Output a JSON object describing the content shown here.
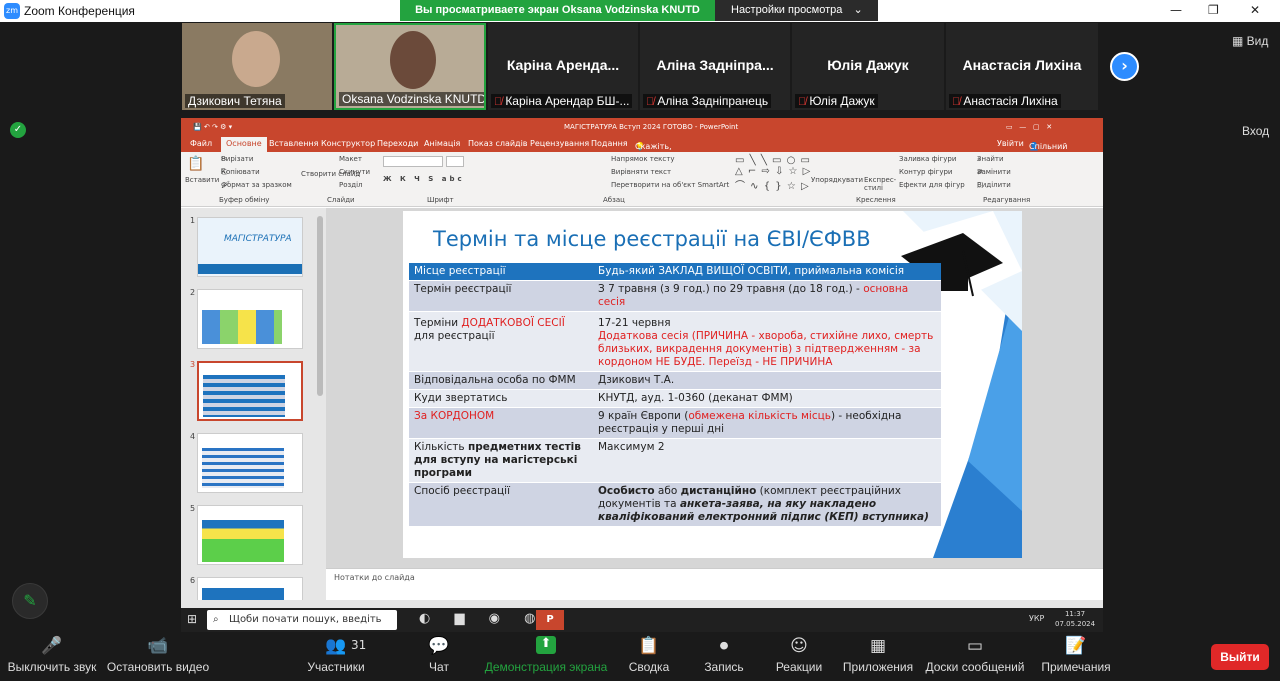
{
  "window": {
    "title": "Zoom Конференция",
    "logo": "zm"
  },
  "share_banner": "Вы просматриваете экран Oksana Vodzinska KNUTD",
  "view_options": "Настройки просмотра",
  "right_buttons": {
    "view": "Вид",
    "exit": "Вход"
  },
  "participants": [
    {
      "big": "",
      "name": "Дзикович Тетяна",
      "muted": false
    },
    {
      "big": "",
      "name": "Oksana Vodzinska KNUTD",
      "muted": false
    },
    {
      "big": "Каріна Аренда...",
      "name": "Каріна Арендар БШ-...",
      "muted": true
    },
    {
      "big": "Аліна Задніпра...",
      "name": "Аліна Задніпранець",
      "muted": true
    },
    {
      "big": "Юлія Дажук",
      "name": "Юлія Дажук",
      "muted": true
    },
    {
      "big": "Анастасія Лихіна",
      "name": "Анастасія Лихіна",
      "muted": true
    }
  ],
  "ppt": {
    "title": "МАГІСТРАТУРА Вступ 2024 ГОТОВО - PowerPoint",
    "signin": "Увійти",
    "share": "Спільний доступ",
    "tabs": [
      "Файл",
      "Основне",
      "Вставлення",
      "Конструктор",
      "Переходи",
      "Анімація",
      "Показ слайдів",
      "Рецензування",
      "Подання"
    ],
    "tell_me": "Скажіть, що потрібно зробити...",
    "ribbon": {
      "paste": "Вставити",
      "cut": "Вирізати",
      "copy": "Копіювати",
      "format_painter": "Формат за зразком",
      "clipboard": "Буфер обміну",
      "new_slide": "Створити слайд",
      "layout": "Макет",
      "reset": "Скинути",
      "section": "Розділ",
      "slides": "Слайди",
      "font": "Шрифт",
      "text_dir": "Напрямок тексту",
      "align_text": "Вирівняти текст",
      "smartart": "Перетворити на об'єкт SmartArt",
      "paragraph": "Абзац",
      "arrange": "Упорядкувати",
      "quick_styles": "Експрес-стилі",
      "fill": "Заливка фігури",
      "outline": "Контур фігури",
      "effects": "Ефекти для фігур",
      "drawing": "Креслення",
      "find": "Знайти",
      "replace": "Замінити",
      "select": "Виділити",
      "editing": "Редагування"
    },
    "notes": "Нотатки до слайда"
  },
  "thumbs": [
    {
      "num": "1",
      "text": "МАГІСТРАТУРА"
    },
    {
      "num": "2",
      "text": ""
    },
    {
      "num": "3",
      "text": ""
    },
    {
      "num": "4",
      "text": ""
    },
    {
      "num": "5",
      "text": ""
    },
    {
      "num": "6",
      "text": ""
    }
  ],
  "slide": {
    "title": "Термін та місце реєстрації на ЄВІ/ЄФВВ",
    "rows": [
      {
        "c1": "Місце реєстрації",
        "c2": "Будь-який ЗАКЛАД ВИЩОЇ ОСВІТИ, приймальна комісія"
      },
      {
        "c1": "Термін реєстрації",
        "c2a": "З 7 травня (з 9 год.) по 29 травня (до 18 год.) - ",
        "c2b": "основна сесія"
      },
      {
        "c1a": "Терміни ",
        "c1b": "ДОДАТКОВОЇ СЕСІЇ",
        "c1c": " для реєстрації",
        "c2a": "17-21 червня",
        "c2b": "Додаткова сесія (ПРИЧИНА - хвороба, стихійне лихо, смерть близьких, викрадення документів) з підтвердженням - за кордоном НЕ БУДЕ. Переїзд - НЕ ПРИЧИНА"
      },
      {
        "c1": "Відповідальна особа по ФММ",
        "c2": "Дзикович Т.А."
      },
      {
        "c1": "Куди звертатись",
        "c2": "КНУТД, ауд. 1-0360 (деканат ФММ)"
      },
      {
        "c1": "За КОРДОНОМ",
        "c2a": "9 країн Європи (",
        "c2b": "обмежена кількість місць",
        "c2c": ") - необхідна реєстрація у перші дні"
      },
      {
        "c1a": "Кількість ",
        "c1b": "предметних тестів для вступу на магістерські програми",
        "c2": "Максимум 2"
      },
      {
        "c1": "Спосіб реєстрації",
        "c2a": "Особисто",
        "c2b": " або ",
        "c2c": "дистанційно",
        "c2d": " (комплект реєстраційних документів та ",
        "c2e": "анкета-заява, на яку накладено кваліфікований електронний підпис (КЕП) вступника)"
      }
    ]
  },
  "taskbar": {
    "search": "Щоби почати пошук, введіть",
    "lang": "УКР",
    "time": "11:37",
    "date": "07.05.2024"
  },
  "controls": [
    {
      "icon": "🎤",
      "label": "Выключить звук"
    },
    {
      "icon": "📹",
      "label": "Остановить видео"
    },
    {
      "icon": "👥",
      "label": "Участники",
      "count": "31"
    },
    {
      "icon": "💬",
      "label": "Чат"
    },
    {
      "icon": "⬆",
      "label": "Демонстрация экрана"
    },
    {
      "icon": "📋",
      "label": "Сводка"
    },
    {
      "icon": "⏺",
      "label": "Запись"
    },
    {
      "icon": "☺",
      "label": "Реакции"
    },
    {
      "icon": "▦",
      "label": "Приложения"
    },
    {
      "icon": "▭",
      "label": "Доски сообщений"
    },
    {
      "icon": "📝",
      "label": "Примечания"
    }
  ],
  "leave": "Выйти",
  "colors": {
    "green": "#23a33f",
    "ppt_red": "#c8462d",
    "zoom_blue": "#2d8cff",
    "leave_red": "#e02828"
  }
}
